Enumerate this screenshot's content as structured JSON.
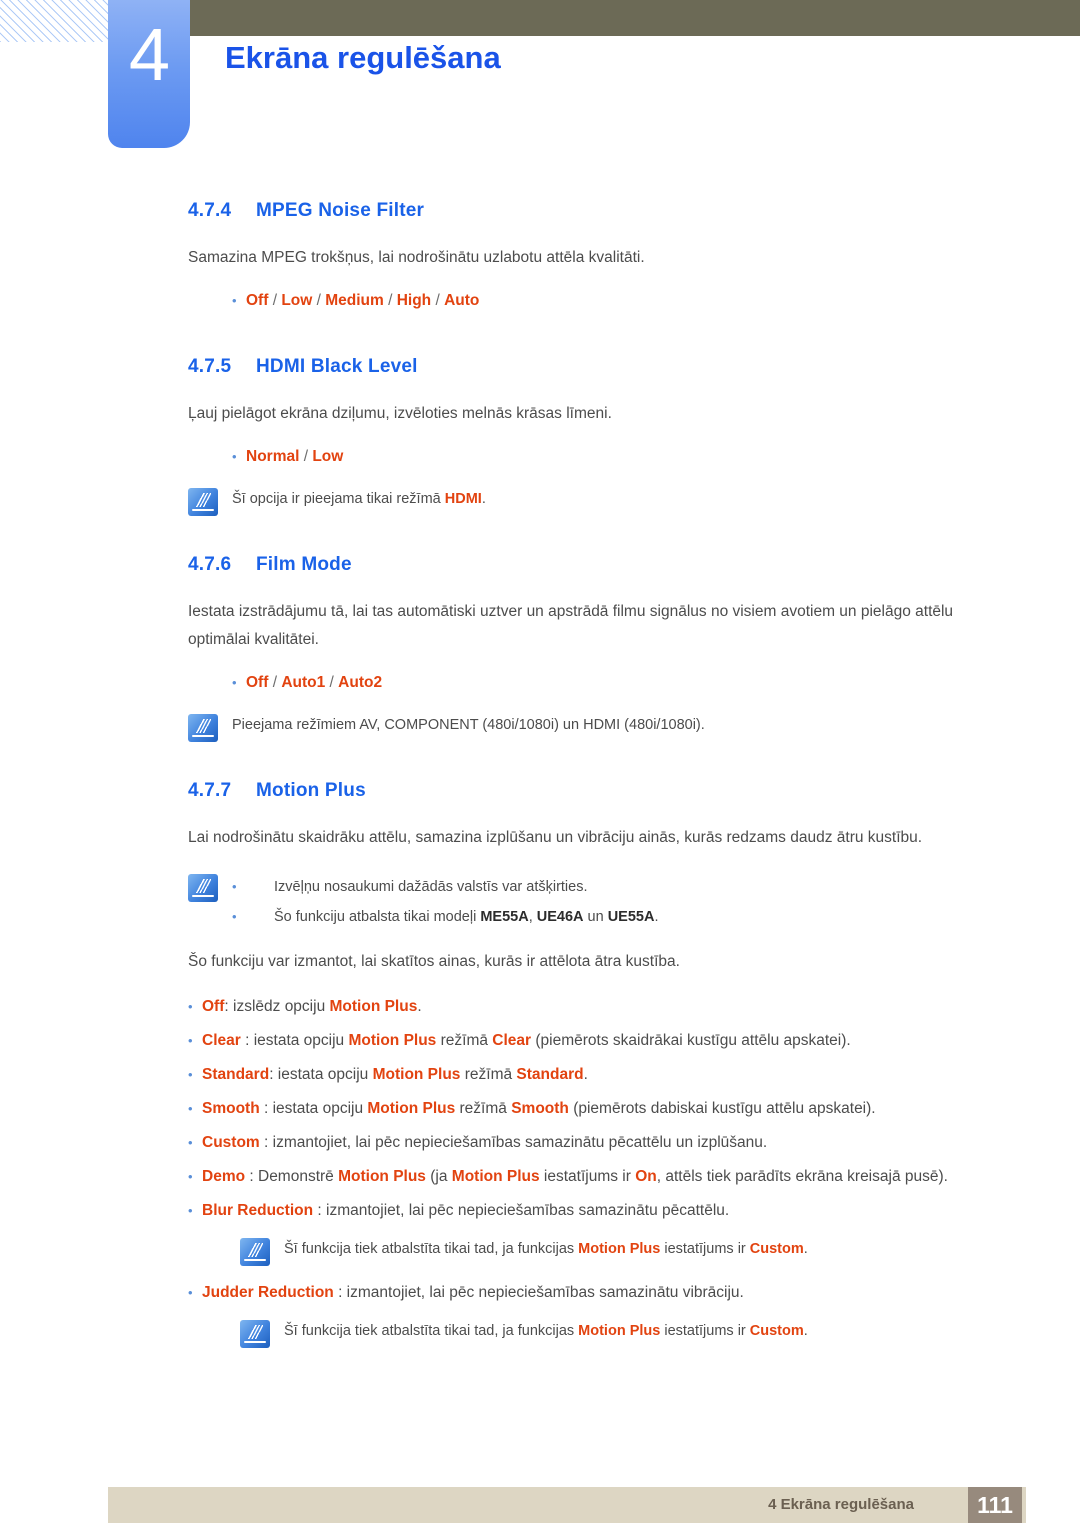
{
  "header": {
    "chapter_number": "4",
    "chapter_title": "Ekrāna regulēšana",
    "accent_blue": "#1a53e8",
    "olive": "#6c6a56",
    "badge_blue": "#6d9bf2"
  },
  "sections": [
    {
      "number": "4.7.4",
      "title": "MPEG Noise Filter",
      "paragraph": "Samazina MPEG trokšņus, lai nodrošinātu uzlabotu attēla kvalitāti.",
      "options": [
        "Off",
        "Low",
        "Medium",
        "High",
        "Auto"
      ]
    },
    {
      "number": "4.7.5",
      "title": "HDMI Black Level",
      "paragraph": "Ļauj pielāgot ekrāna dziļumu, izvēloties melnās krāsas līmeni.",
      "options": [
        "Normal",
        "Low"
      ],
      "note_pre": "Šī opcija ir pieejama tikai režīmā ",
      "note_hl": "HDMI",
      "note_post": "."
    },
    {
      "number": "4.7.6",
      "title": "Film Mode",
      "paragraph": "Iestata izstrādājumu tā, lai tas automātiski uztver un apstrādā filmu signālus no visiem avotiem un pielāgo attēlu optimālai kvalitātei.",
      "options": [
        "Off",
        "Auto1",
        "Auto2"
      ],
      "note_plain": "Pieejama režīmiem AV, COMPONENT (480i/1080i) un HDMI (480i/1080i)."
    },
    {
      "number": "4.7.7",
      "title": "Motion Plus",
      "paragraph": "Lai nodrošinātu skaidrāku attēlu, samazina izplūšanu un vibrāciju ainās, kurās redzams daudz ātru kustību."
    }
  ],
  "motion_plus": {
    "note_bullets": [
      {
        "text": "Izvēļņu nosaukumi dažādās valstīs var atšķirties."
      },
      {
        "pre": "Šo funkciju atbalsta tikai modeļi ",
        "m1": "ME55A",
        "mid1": ", ",
        "m2": "UE46A",
        "mid2": " un ",
        "m3": "UE55A",
        "post": "."
      }
    ],
    "intro": "Šo funkciju var izmantot, lai skatītos ainas, kurās ir attēlota ātra kustība.",
    "items": [
      {
        "name": "Off",
        "parts": [
          {
            "t": ": izslēdz opciju ",
            "s": "gray"
          },
          {
            "t": "Motion Plus",
            "s": "opt"
          },
          {
            "t": ".",
            "s": "gray"
          }
        ]
      },
      {
        "name": "Clear",
        "parts": [
          {
            "t": " : iestata opciju ",
            "s": "gray"
          },
          {
            "t": "Motion Plus",
            "s": "opt"
          },
          {
            "t": " režīmā ",
            "s": "gray"
          },
          {
            "t": "Clear",
            "s": "opt"
          },
          {
            "t": " (piemērots skaidrākai kustīgu attēlu apskatei).",
            "s": "gray"
          }
        ]
      },
      {
        "name": "Standard",
        "parts": [
          {
            "t": ": iestata opciju  ",
            "s": "gray"
          },
          {
            "t": "Motion Plus",
            "s": "opt"
          },
          {
            "t": " režīmā ",
            "s": "gray"
          },
          {
            "t": "Standard",
            "s": "opt"
          },
          {
            "t": ".",
            "s": "gray"
          }
        ]
      },
      {
        "name": "Smooth",
        "parts": [
          {
            "t": " : iestata opciju ",
            "s": "gray"
          },
          {
            "t": "Motion Plus",
            "s": "opt"
          },
          {
            "t": " režīmā ",
            "s": "gray"
          },
          {
            "t": "Smooth",
            "s": "opt"
          },
          {
            "t": " (piemērots dabiskai kustīgu attēlu apskatei).",
            "s": "gray"
          }
        ]
      },
      {
        "name": "Custom",
        "parts": [
          {
            "t": " : izmantojiet, lai pēc nepieciešamības samazinātu pēcattēlu un izplūšanu.",
            "s": "gray"
          }
        ]
      },
      {
        "name": "Demo",
        "parts": [
          {
            "t": " : Demonstrē ",
            "s": "gray"
          },
          {
            "t": "Motion Plus",
            "s": "opt"
          },
          {
            "t": " (ja ",
            "s": "gray"
          },
          {
            "t": "Motion Plus",
            "s": "opt"
          },
          {
            "t": " iestatījums ir ",
            "s": "gray"
          },
          {
            "t": "On",
            "s": "opt"
          },
          {
            "t": ", attēls tiek parādīts ekrāna kreisajā pusē).",
            "s": "gray"
          }
        ]
      },
      {
        "name": "Blur Reduction",
        "parts": [
          {
            "t": " : izmantojiet, lai pēc nepieciešamības samazinātu pēcattēlu.",
            "s": "gray"
          }
        ]
      }
    ],
    "blur_note": {
      "pre": "Šī funkcija tiek atbalstīta tikai tad, ja funkcijas ",
      "hl1": "Motion Plus",
      "mid": " iestatījums ir ",
      "hl2": "Custom",
      "post": "."
    },
    "judder_item": {
      "name": "Judder Reduction",
      "rest": " : izmantojiet, lai pēc nepieciešamības samazinātu vibrāciju."
    },
    "judder_note": {
      "pre": "Šī funkcija tiek atbalstīta tikai tad, ja funkcijas ",
      "hl1": "Motion Plus",
      "mid": " iestatījums ir ",
      "hl2": "Custom",
      "post": "."
    }
  },
  "footer": {
    "text": "4 Ekrāna regulēšana",
    "page": "111"
  },
  "icons": {
    "bullet": "•",
    "note": "note-pen-icon"
  }
}
